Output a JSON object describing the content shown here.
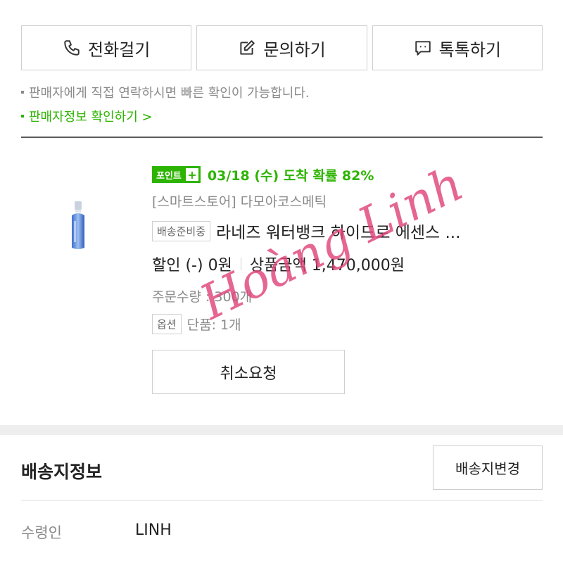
{
  "contact_buttons": [
    {
      "label": "전화걸기",
      "icon": "phone-icon"
    },
    {
      "label": "문의하기",
      "icon": "edit-icon"
    },
    {
      "label": "톡톡하기",
      "icon": "chat-icon"
    }
  ],
  "notices": {
    "direct_contact": "판매자에게 직접 연락하시면 빠른 확인이 가능합니다.",
    "seller_info_link": "판매자정보 확인하기 >"
  },
  "order": {
    "point_badge": "포인트",
    "arrival": "03/18 (수) 도착 확률 82%",
    "store": "[스마트스토어] 다모아코스메틱",
    "status_tag": "배송준비중",
    "product_name": "라네즈 워터뱅크 하이드로 에센스 ...",
    "discount": "할인 (-) 0원",
    "price": "상품금액 1,470,000원",
    "quantity": "주문수량 : 300개",
    "option_tag": "옵션",
    "option_value": "단품: 1개",
    "cancel_button": "취소요청"
  },
  "watermark": "Hoàng Linh",
  "shipping": {
    "title": "배송지정보",
    "change_button": "배송지변경",
    "receiver_label": "수령인",
    "receiver_value": "LINH"
  },
  "colors": {
    "accent_green": "#2db400",
    "watermark_pink": "#e0457b"
  }
}
